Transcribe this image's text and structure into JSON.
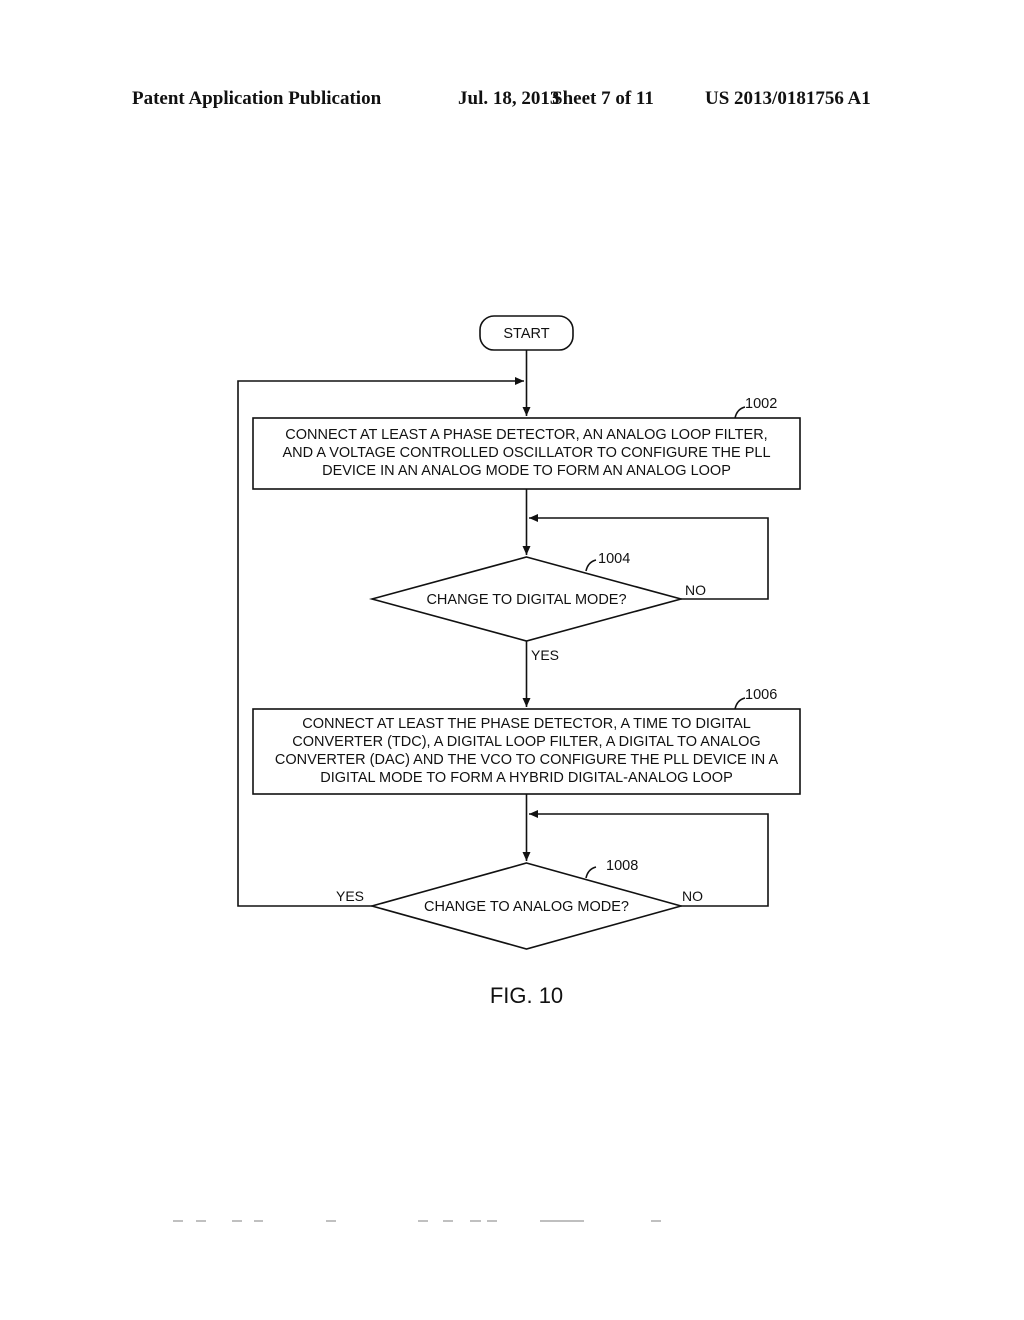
{
  "header": {
    "publication": "Patent Application Publication",
    "date": "Jul. 18, 2013",
    "sheet": "Sheet 7 of 11",
    "number": "US 2013/0181756 A1"
  },
  "flowchart": {
    "start": "START",
    "step_1002": {
      "ref": "1002",
      "lines": [
        "CONNECT AT LEAST A PHASE DETECTOR, AN ANALOG LOOP FILTER,",
        "AND A VOLTAGE CONTROLLED OSCILLATOR TO CONFIGURE THE  PLL",
        "DEVICE IN AN ANALOG MODE TO FORM AN ANALOG LOOP"
      ]
    },
    "decision_1004": {
      "ref": "1004",
      "text": "CHANGE TO DIGITAL MODE?",
      "no_label": "NO",
      "yes_label": "YES"
    },
    "step_1006": {
      "ref": "1006",
      "lines": [
        "CONNECT AT LEAST THE PHASE DETECTOR, A TIME TO DIGITAL",
        "CONVERTER (TDC), A DIGITAL LOOP FILTER, A DIGITAL TO ANALOG",
        "CONVERTER (DAC) AND THE VCO TO CONFIGURE THE PLL DEVICE IN A",
        "DIGITAL MODE TO FORM A HYBRID DIGITAL-ANALOG LOOP"
      ]
    },
    "decision_1008": {
      "ref": "1008",
      "text": "CHANGE TO ANALOG MODE?",
      "no_label": "NO",
      "yes_label": "YES"
    }
  },
  "figure_label": "FIG. 10"
}
